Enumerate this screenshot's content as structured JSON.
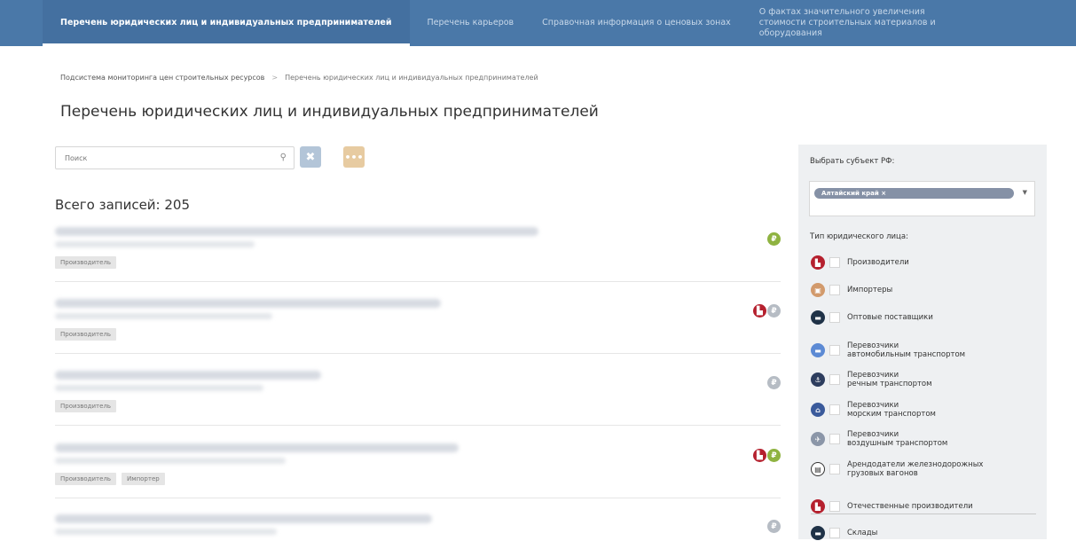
{
  "nav": {
    "tabs": [
      {
        "label": "Перечень юридических лиц и индивидуальных предпринимателей"
      },
      {
        "label": "Перечень карьеров"
      },
      {
        "label": "Справочная информация о ценовых зонах"
      },
      {
        "label": "О фактах значительного увеличения стоимости строительных материалов и оборудования"
      }
    ]
  },
  "breadcrumb": {
    "root": "Подсистема мониторинга цен строительных ресурсов",
    "separator": ">",
    "current": "Перечень юридических лиц и индивидуальных предпринимателей"
  },
  "page_title": "Перечень юридических лиц и индивидуальных предпринимателей",
  "search": {
    "placeholder": "Поиск",
    "clear_icon": "close-icon",
    "more_icon": "ellipsis-icon"
  },
  "total_label": "Всего записей: 205",
  "records": [
    {
      "tags": [
        "Производитель"
      ],
      "icons": [
        "ruble-green"
      ]
    },
    {
      "tags": [
        "Производитель"
      ],
      "icons": [
        "factory-red",
        "ruble-grey"
      ]
    },
    {
      "tags": [
        "Производитель"
      ],
      "icons": [
        "ruble-grey"
      ]
    },
    {
      "tags": [
        "Производитель",
        "Импортер"
      ],
      "icons": [
        "factory-red",
        "ruble-green"
      ]
    },
    {
      "tags": [],
      "icons": [
        "ruble-grey"
      ]
    }
  ],
  "sidebar": {
    "region_label": "Выбрать субъект РФ:",
    "region_value": "Алтайский край ×",
    "type_label": "Тип юридического лица:",
    "types": [
      {
        "label": "Производители",
        "icon": "factory-icon",
        "color": "#b5202e"
      },
      {
        "label": "Импортеры",
        "icon": "import-icon",
        "color": "#d29a6c"
      },
      {
        "label": "Оптовые поставщики",
        "icon": "truck-icon",
        "color": "#1f3247"
      },
      {
        "label": "Перевозчики\nавтомобильным транспортом",
        "icon": "car-icon",
        "color": "#5c8ad4"
      },
      {
        "label": "Перевозчики\nречным транспортом",
        "icon": "anchor-icon",
        "color": "#2d3d5e"
      },
      {
        "label": "Перевозчики\nморским транспортом",
        "icon": "ship-icon",
        "color": "#3a5a9b"
      },
      {
        "label": "Перевозчики\nвоздушным транспортом",
        "icon": "plane-icon",
        "color": "#8b96a8"
      },
      {
        "label": "Арендодатели железнодорожных\nгрузовых вагонов",
        "icon": "rail-icon",
        "color": "#ffffff"
      }
    ],
    "extra_types": [
      {
        "label": "Отечественные производители",
        "icon": "factory-flag-icon",
        "color": "#b5202e"
      },
      {
        "label": "Склады",
        "icon": "warehouse-icon",
        "color": "#1f3247"
      }
    ]
  }
}
